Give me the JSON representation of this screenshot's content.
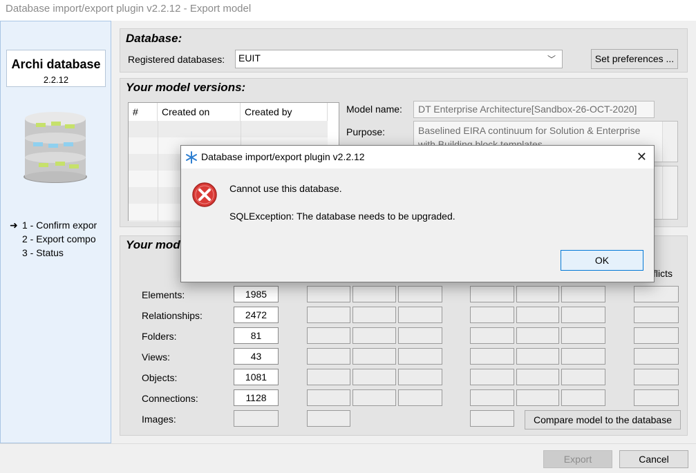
{
  "window": {
    "title": "Database import/export plugin v2.2.12 - Export model"
  },
  "sidebar": {
    "brand_title": "Archi database",
    "brand_version": "2.2.12",
    "steps": [
      {
        "label": "1 - Confirm expor",
        "current": true
      },
      {
        "label": "2 - Export compo",
        "current": false
      },
      {
        "label": "3 - Status",
        "current": false
      }
    ]
  },
  "database": {
    "title": "Database:",
    "registered_label": "Registered databases:",
    "selected": "EUIT",
    "set_pref_label": "Set preferences ..."
  },
  "versions": {
    "title": "Your model versions:",
    "columns": [
      "#",
      "Created on",
      "Created by"
    ],
    "model_name_label": "Model name:",
    "model_name_value": "DT Enterprise Architecture[Sandbox-26-OCT-2020]",
    "purpose_label": "Purpose:",
    "purpose_value": "Baselined EIRA continuum for Solution & Enterprise with Building block templates"
  },
  "model": {
    "title": "Your mod",
    "conflicts_fragment": "flicts",
    "rows": [
      {
        "label": "Elements:",
        "count": "1985"
      },
      {
        "label": "Relationships:",
        "count": "2472"
      },
      {
        "label": "Folders:",
        "count": "81"
      },
      {
        "label": "Views:",
        "count": "43"
      },
      {
        "label": "Objects:",
        "count": "1081"
      },
      {
        "label": "Connections:",
        "count": "1128"
      },
      {
        "label": "Images:",
        "count": ""
      }
    ],
    "compare_label": "Compare model to the database"
  },
  "footer": {
    "export_label": "Export",
    "cancel_label": "Cancel"
  },
  "dialog": {
    "title": "Database import/export plugin v2.2.12",
    "message": "Cannot use this database.",
    "detail": "SQLException: The database needs to be upgraded.",
    "ok_label": "OK"
  },
  "colors": {
    "accent": "#0078d7",
    "error": "#d32f2f",
    "sidebar_bg": "#e8f1fb"
  }
}
